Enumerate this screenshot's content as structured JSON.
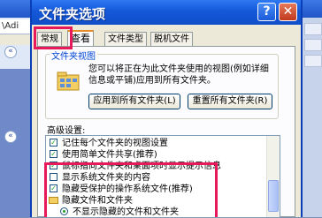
{
  "background": {
    "address_text": "\\Adi",
    "expanders": [
      "«",
      "«"
    ]
  },
  "dialog": {
    "title": "文件夹选项",
    "help_glyph": "?",
    "close_glyph": "✕",
    "tabs": [
      {
        "label": "常规"
      },
      {
        "label": "查看",
        "active": true
      },
      {
        "label": "文件类型"
      },
      {
        "label": "脱机文件"
      }
    ],
    "folder_views": {
      "legend": "文件夹视图",
      "description": "您可以将正在为此文件夹使用的视图(例如详细信息或平铺)应用到所有文件夹。",
      "apply_button": "应用到所有文件夹(L)",
      "reset_button": "重置所有文件夹(R)"
    },
    "advanced": {
      "label": "高级设置:",
      "items": [
        {
          "kind": "checkbox",
          "checked": true,
          "indent": 0,
          "text": "记住每个文件夹的视图设置"
        },
        {
          "kind": "checkbox",
          "checked": true,
          "indent": 0,
          "text": "使用简单文件共享(推荐)"
        },
        {
          "kind": "checkbox",
          "checked": true,
          "indent": 0,
          "text": "鼠标指向文件夹和桌面项时显示提示信息"
        },
        {
          "kind": "checkbox",
          "checked": false,
          "indent": 0,
          "text": "显示系统文件夹的内容"
        },
        {
          "kind": "checkbox",
          "checked": true,
          "indent": 0,
          "text": "隐藏受保护的操作系统文件(推荐)"
        },
        {
          "kind": "folder",
          "indent": 0,
          "text": "隐藏文件和文件夹"
        },
        {
          "kind": "radio",
          "checked": true,
          "indent": 1,
          "text": "不显示隐藏的文件和文件夹"
        }
      ]
    }
  },
  "colors": {
    "highlight": "#e8195a",
    "titlebar": "#1458d9"
  }
}
